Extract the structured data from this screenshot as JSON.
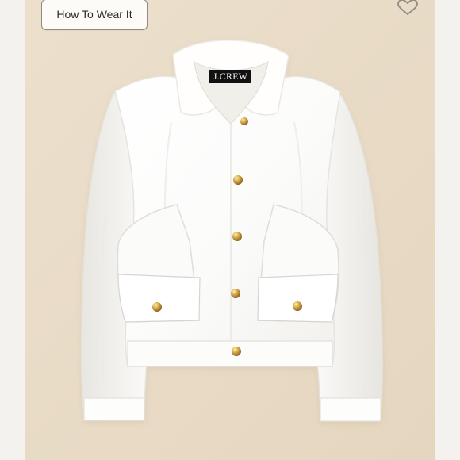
{
  "screen": {
    "background": "#f7f4ef",
    "photo_background": "#eadcc7",
    "accent_gold": "#c79c45"
  },
  "overlay": {
    "how_to_wear_label": "How To Wear It",
    "favorite_icon": "heart-outline-icon"
  },
  "product_image": {
    "brand_label": "J.CREW",
    "garment_color": "#ffffff",
    "button_color": "#c79c45"
  }
}
